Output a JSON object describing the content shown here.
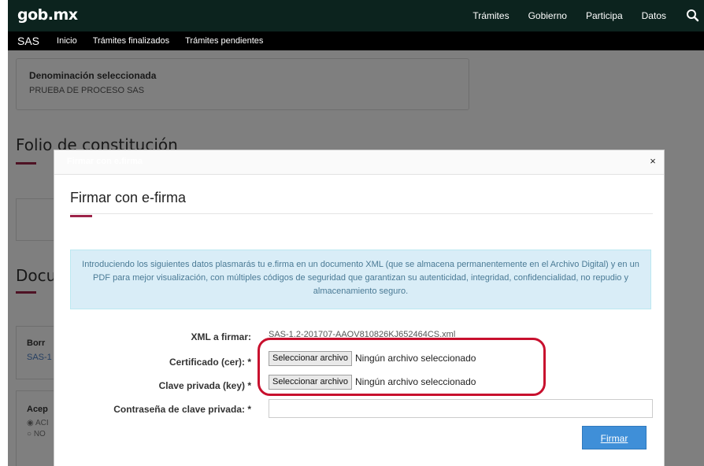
{
  "topnav": {
    "brand": "gob.mx",
    "links": [
      "Trámites",
      "Gobierno",
      "Participa",
      "Datos"
    ]
  },
  "subnav": {
    "section": "SAS",
    "links": [
      "Inicio",
      "Trámites finalizados",
      "Trámites pendientes"
    ]
  },
  "background": {
    "denominacion_title": "Denominación seleccionada",
    "denominacion_value": "PRUEBA DE PROCESO SAS",
    "folio_heading": "Folio de constitución",
    "docu_heading": "Docu",
    "borr_label": "Borr",
    "sas_link": "SAS-1",
    "acep_label": "Acep",
    "radio1": "◉ ACI",
    "radio2": "○ NO"
  },
  "modal": {
    "header_title": "Firmar con e.firma",
    "title": "Firmar con e-firma",
    "info": "Introduciendo los siguientes datos plasmarás tu e.firma en un documento XML (que se almacena permanentemente en el Archivo Digital) y en un PDF para mejor visualización, con múltiples códigos de seguridad que garantizan su autenticidad, integridad, confidencialidad, no repudio y almacenamiento seguro.",
    "xml_label": "XML a firmar:",
    "xml_value": "SAS-1.2-201707-AAOV810826KJ652464CS.xml",
    "cert_label": "Certificado (cer): *",
    "key_label": "Clave privada (key) *",
    "password_label": "Contraseña de clave privada: *",
    "file_button": "Seleccionar archivo",
    "file_status": "Ningún archivo seleccionado",
    "submit": "Firmar",
    "close": "×"
  },
  "colors": {
    "nav_dark": "#0c231e",
    "accent_red": "#9d2449",
    "alert_bg": "#d9edf7",
    "button_blue": "#3f8fd8",
    "highlight_red": "#c8102e"
  }
}
